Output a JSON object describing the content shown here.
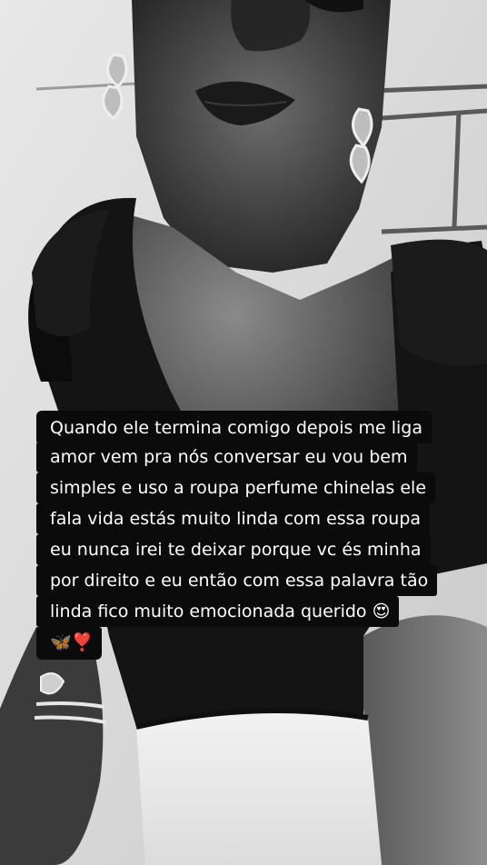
{
  "caption": {
    "lines": [
      "Quando ele termina comigo depois me liga",
      "amor vem pra nós conversar eu vou bem",
      "simples e uso a roupa perfume chinelas ele",
      "fala vida estás muito linda com essa roupa",
      "eu nunca irei te deixar porque vc és minha",
      "por direito e eu então com essa palavra tão",
      "linda fico muito emocionada querido 😍",
      "🦋❣️"
    ]
  },
  "colors": {
    "caption_bg": "#0b0b0b",
    "caption_text": "#ffffff"
  }
}
